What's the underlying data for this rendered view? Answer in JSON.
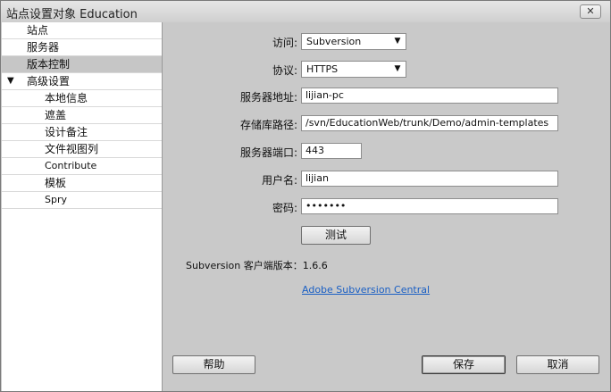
{
  "window": {
    "title": "站点设置对象 Education",
    "close_label": "✕"
  },
  "sidebar": {
    "items": [
      {
        "label": "站点"
      },
      {
        "label": "服务器"
      },
      {
        "label": "版本控制"
      },
      {
        "label": "高级设置",
        "arrow": "▼"
      },
      {
        "label": "本地信息"
      },
      {
        "label": "遮盖"
      },
      {
        "label": "设计备注"
      },
      {
        "label": "文件视图列"
      },
      {
        "label": "Contribute"
      },
      {
        "label": "模板"
      },
      {
        "label": "Spry"
      }
    ]
  },
  "form": {
    "access": {
      "label": "访问:",
      "value": "Subversion"
    },
    "protocol": {
      "label": "协议:",
      "value": "HTTPS"
    },
    "server_address": {
      "label": "服务器地址:",
      "value": "lijian-pc"
    },
    "repo_path": {
      "label": "存储库路径:",
      "value": "/svn/EducationWeb/trunk/Demo/admin-templates"
    },
    "server_port": {
      "label": "服务器端口:",
      "value": "443"
    },
    "username": {
      "label": "用户名:",
      "value": "lijian"
    },
    "password": {
      "label": "密码:",
      "value": "•••••••"
    },
    "test_button": "测试",
    "client_version": "Subversion 客户端版本：1.6.6",
    "central_link": "Adobe Subversion Central"
  },
  "footer": {
    "help": "帮助",
    "save": "保存",
    "cancel": "取消"
  }
}
